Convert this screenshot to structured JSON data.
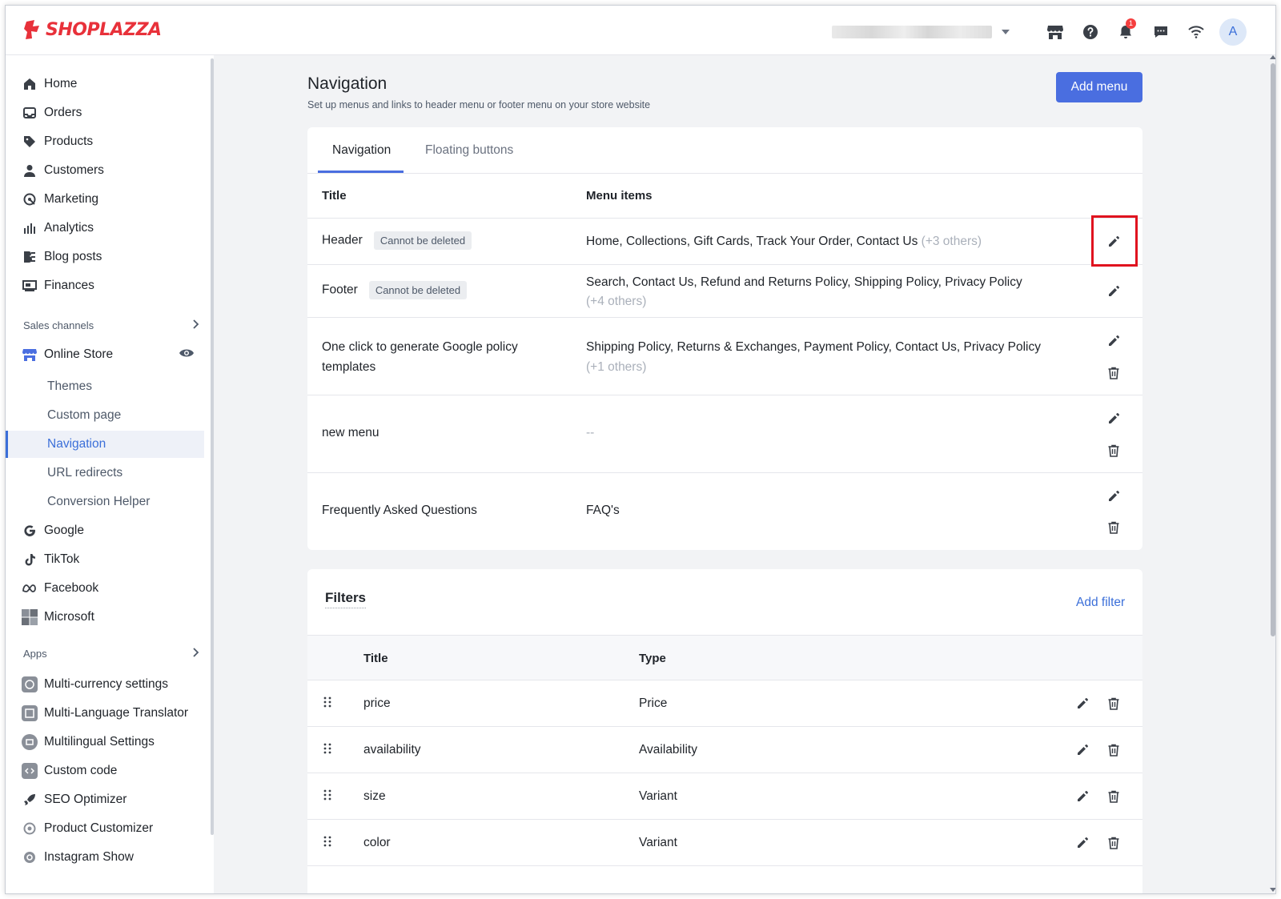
{
  "app": {
    "brand": "SHOPLAZZA",
    "brand_color": "#e8313a",
    "accent_color": "#4a6ee0",
    "avatar_initial": "A",
    "notification_count": "1",
    "top_icons": [
      "store-icon",
      "help-icon",
      "bell-icon",
      "chat-icon",
      "wifi-icon"
    ]
  },
  "sidebar": {
    "main_items": [
      {
        "label": "Home",
        "icon": "home-icon"
      },
      {
        "label": "Orders",
        "icon": "orders-icon"
      },
      {
        "label": "Products",
        "icon": "tag-icon"
      },
      {
        "label": "Customers",
        "icon": "person-icon"
      },
      {
        "label": "Marketing",
        "icon": "marketing-icon"
      },
      {
        "label": "Analytics",
        "icon": "bar-chart-icon"
      },
      {
        "label": "Blog posts",
        "icon": "blog-icon"
      },
      {
        "label": "Finances",
        "icon": "finances-icon"
      }
    ],
    "sales_channels_label": "Sales channels",
    "online_store_label": "Online Store",
    "online_store_sub": [
      {
        "label": "Themes"
      },
      {
        "label": "Custom page"
      },
      {
        "label": "Navigation",
        "active": true
      },
      {
        "label": "URL redirects"
      },
      {
        "label": "Conversion Helper"
      }
    ],
    "channels": [
      {
        "label": "Google",
        "icon": "google-icon"
      },
      {
        "label": "TikTok",
        "icon": "tiktok-icon"
      },
      {
        "label": "Facebook",
        "icon": "meta-icon"
      },
      {
        "label": "Microsoft",
        "icon": "microsoft-icon"
      }
    ],
    "apps_label": "Apps",
    "apps": [
      {
        "label": "Multi-currency settings",
        "icon": "currency-app-icon"
      },
      {
        "label": "Multi-Language Translator",
        "icon": "translator-app-icon"
      },
      {
        "label": "Multilingual Settings",
        "icon": "multilingual-app-icon"
      },
      {
        "label": "Custom code",
        "icon": "code-app-icon"
      },
      {
        "label": "SEO Optimizer",
        "icon": "rocket-icon"
      },
      {
        "label": "Product Customizer",
        "icon": "customizer-icon"
      },
      {
        "label": "Instagram Show",
        "icon": "instagram-icon"
      }
    ]
  },
  "page": {
    "title": "Navigation",
    "subtitle": "Set up menus and links to header menu or footer menu on your store website",
    "add_menu_label": "Add menu"
  },
  "tabs": [
    {
      "label": "Navigation",
      "active": true
    },
    {
      "label": "Floating buttons",
      "active": false
    }
  ],
  "menus_table": {
    "col_title": "Title",
    "col_items": "Menu items",
    "rows": [
      {
        "title": "Header",
        "tag": "Cannot be deleted",
        "items": "Home, Collections, Gift Cards, Track Your Order, Contact Us",
        "extra": "(+3 others)",
        "deletable": false
      },
      {
        "title": "Footer",
        "tag": "Cannot be deleted",
        "items": "Search, Contact Us, Refund and Returns Policy, Shipping Policy, Privacy Policy",
        "extra": "(+4 others)",
        "deletable": false
      },
      {
        "title": "One click to generate Google policy templates",
        "tag": "",
        "items": "Shipping Policy, Returns & Exchanges, Payment Policy, Contact Us, Privacy Policy",
        "extra": "(+1 others)",
        "deletable": true
      },
      {
        "title": "new menu",
        "tag": "",
        "items": "--",
        "extra": "",
        "deletable": true
      },
      {
        "title": "Frequently Asked Questions",
        "tag": "",
        "items": "FAQ's",
        "extra": "",
        "deletable": true
      }
    ]
  },
  "filters": {
    "title": "Filters",
    "add_label": "Add filter",
    "col_title": "Title",
    "col_type": "Type",
    "rows": [
      {
        "title": "price",
        "type": "Price"
      },
      {
        "title": "availability",
        "type": "Availability"
      },
      {
        "title": "size",
        "type": "Variant"
      },
      {
        "title": "color",
        "type": "Variant"
      }
    ]
  }
}
